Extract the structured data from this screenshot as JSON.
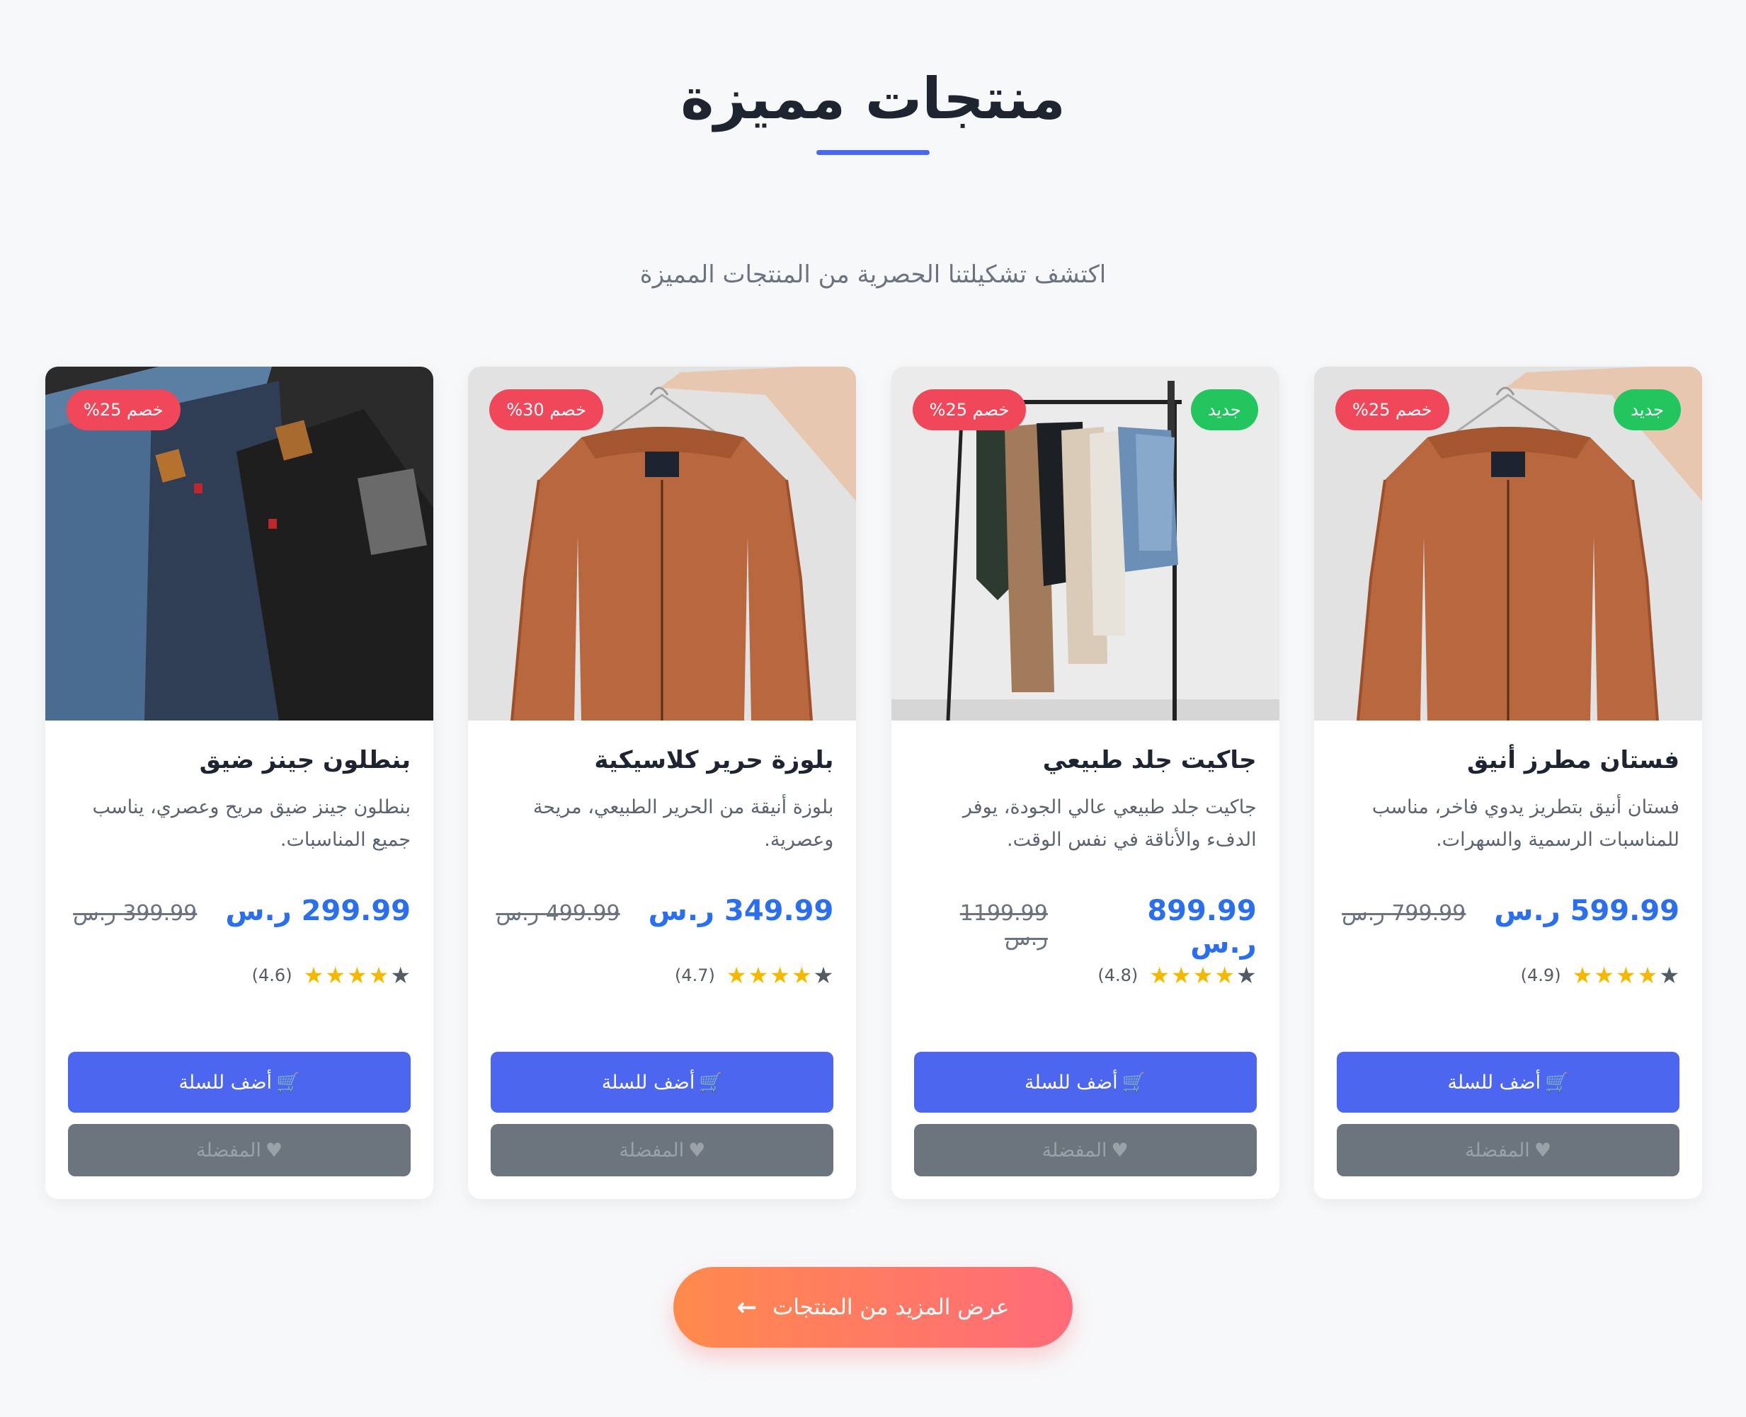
{
  "header": {
    "title": "منتجات مميزة",
    "subtitle": "اكتشف تشكيلتنا الحصرية من المنتجات المميزة"
  },
  "products": [
    {
      "badge_new": "جديد",
      "badge_discount": "خصم 25%",
      "image": "orange-jacket-on-hanger",
      "title": "فستان مطرز أنيق",
      "description": "فستان أنيق بتطريز يدوي فاخر، مناسب للمناسبات الرسمية والسهرات.",
      "price": "599.99 ر.س",
      "old_price": "799.99 ر.س",
      "rating": 4.9,
      "rating_text": "(4.9)",
      "add_to_cart": "أضف للسلة",
      "favorite": "المفضلة"
    },
    {
      "badge_new": "جديد",
      "badge_discount": "خصم 25%",
      "image": "clothes-rack",
      "title": "جاكيت جلد طبيعي",
      "description": "جاكيت جلد طبيعي عالي الجودة، يوفر الدفء والأناقة في نفس الوقت.",
      "price": "899.99 ر.س",
      "old_price": "1199.99 ر.س",
      "rating": 4.8,
      "rating_text": "(4.8)",
      "add_to_cart": "أضف للسلة",
      "favorite": "المفضلة"
    },
    {
      "badge_new": "",
      "badge_discount": "خصم 30%",
      "image": "orange-jacket-on-hanger",
      "title": "بلوزة حرير كلاسيكية",
      "description": "بلوزة أنيقة من الحرير الطبيعي، مريحة وعصرية.",
      "price": "349.99 ر.س",
      "old_price": "499.99 ر.س",
      "rating": 4.7,
      "rating_text": "(4.7)",
      "add_to_cart": "أضف للسلة",
      "favorite": "المفضلة"
    },
    {
      "badge_new": "",
      "badge_discount": "خصم 25%",
      "image": "jeans-stack",
      "title": "بنطلون جينز ضيق",
      "description": "بنطلون جينز ضيق مريح وعصري، يناسب جميع المناسبات.",
      "price": "299.99 ر.س",
      "old_price": "399.99 ر.س",
      "rating": 4.6,
      "rating_text": "(4.6)",
      "add_to_cart": "أضف للسلة",
      "favorite": "المفضلة"
    }
  ],
  "view_more": "عرض المزيد من المنتجات",
  "colors": {
    "accent": "#4a68ee",
    "price": "#2b6ff0",
    "discount_badge": "#f0475a",
    "new_badge": "#22c55e",
    "star": "#f5b800",
    "favorite_button": "#6c757d",
    "cta_gradient_start": "#ff6b7a",
    "cta_gradient_end": "#ff8a4c"
  },
  "icons": {
    "cart": "cart-icon",
    "heart": "heart-icon",
    "star": "star-icon",
    "arrow": "arrow-left-icon"
  }
}
